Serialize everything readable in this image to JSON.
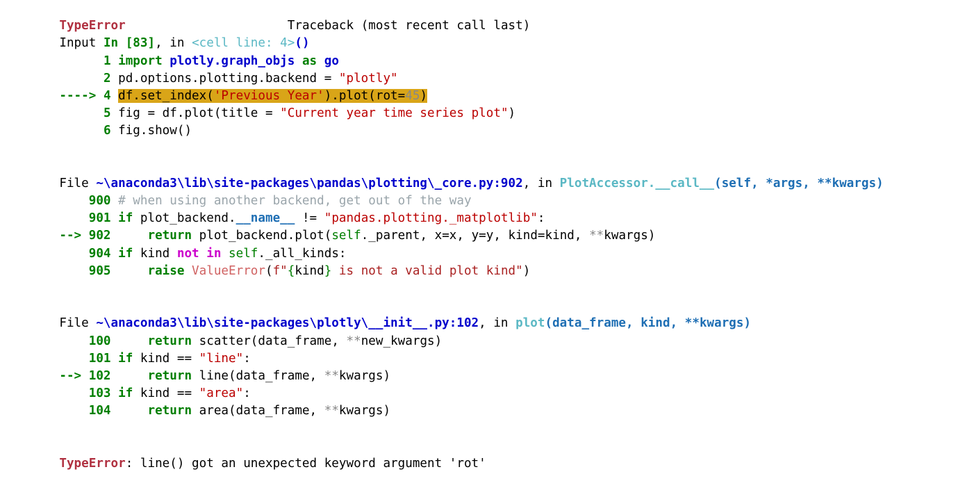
{
  "terminal": {
    "kind": "ipython-traceback",
    "background": "#ffffff",
    "exception_type": "TypeError",
    "traceback_header": "Traceback (most recent call last)",
    "final_message_label": "TypeError",
    "final_message_text": ": line() got an unexpected keyword argument 'rot'",
    "colors": {
      "error_red": "#b03040",
      "keyword_green": "#007f00",
      "module_blue": "#0000cc",
      "func_cyan": "#5bb8c4",
      "string_red": "#bb0000",
      "comment_grey": "#9aa5ab",
      "highlight_gold": "#d9a518",
      "magenta_keyword": "#cc00cc",
      "valueerror_salmon": "#d06262",
      "splat_grey": "#888888"
    }
  },
  "frames": {
    "frame1": {
      "location_prefix": "Input ",
      "cell_id": "In [83]",
      "location_middle": ", in ",
      "cell_scope": "<cell line: 4>",
      "call_parens": "()",
      "lines": [
        {
          "num": "1",
          "arrow": "",
          "highlight": false
        },
        {
          "num": "2",
          "arrow": "",
          "highlight": false
        },
        {
          "num": "4",
          "arrow": "---->",
          "highlight": true
        },
        {
          "num": "5",
          "arrow": "",
          "highlight": false
        },
        {
          "num": "6",
          "arrow": "",
          "highlight": false
        }
      ],
      "code": {
        "l1_import": "import",
        "l1_module": "plotly.graph_objs",
        "l1_as": "as",
        "l1_alias": "go",
        "l2_expr": "pd.options.plotting.backend = ",
        "l2_str": "\"plotly\"",
        "l4_a": "df.set_index(",
        "l4_str": "'Previous Year'",
        "l4_b": ").plot(rot=",
        "l4_num": "45",
        "l4_c": ")",
        "l5_a": "fig = df.plot(title = ",
        "l5_str": "\"Current year time series plot\"",
        "l5_b": ")",
        "l6": "fig.show()"
      }
    },
    "frame2": {
      "file_word": "File ",
      "path": "~\\anaconda3\\lib\\site-packages\\pandas\\plotting\\_core.py:902",
      "in_word": ", in ",
      "func_name": "PlotAccessor.__call__",
      "signature": "(self, *args, **kwargs)",
      "lines": [
        {
          "num": "900",
          "arrow": "",
          "highlight": false
        },
        {
          "num": "901",
          "arrow": "",
          "highlight": false
        },
        {
          "num": "902",
          "arrow": "-->",
          "highlight": false
        },
        {
          "num": "904",
          "arrow": "",
          "highlight": false
        },
        {
          "num": "905",
          "arrow": "",
          "highlight": false
        }
      ],
      "code": {
        "l900_comment": "# when using another backend, get out of the way",
        "l901_if": "if",
        "l901_a": " plot_backend.",
        "l901_dunder": "__name__",
        "l901_b": " != ",
        "l901_str": "\"pandas.plotting._matplotlib\"",
        "l901_c": ":",
        "l902_return": "return",
        "l902_a": " plot_backend.plot(",
        "l902_self": "self",
        "l902_b": "._parent, x=x, y=y, kind=kind, ",
        "l902_splat": "**",
        "l902_c": "kwargs)",
        "l904_if": "if",
        "l904_a": " kind ",
        "l904_notin": "not in",
        "l904_self": " self",
        "l904_b": "._all_kinds:",
        "l905_raise": "raise",
        "l905_valerr": " ValueError",
        "l905_a": "(",
        "l905_f": "f\"",
        "l905_lbrace": "{",
        "l905_kind": "kind",
        "l905_rbrace": "}",
        "l905_rest": " is not a valid plot kind\"",
        "l905_close": ")"
      }
    },
    "frame3": {
      "file_word": "File ",
      "path": "~\\anaconda3\\lib\\site-packages\\plotly\\__init__.py:102",
      "in_word": ", in ",
      "func_name": "plot",
      "signature": "(data_frame, kind, **kwargs)",
      "lines": [
        {
          "num": "100",
          "arrow": "",
          "highlight": false
        },
        {
          "num": "101",
          "arrow": "",
          "highlight": false
        },
        {
          "num": "102",
          "arrow": "-->",
          "highlight": false
        },
        {
          "num": "103",
          "arrow": "",
          "highlight": false
        },
        {
          "num": "104",
          "arrow": "",
          "highlight": false
        }
      ],
      "code": {
        "l100_return": "return",
        "l100_a": " scatter(data_frame, ",
        "l100_splat": "**",
        "l100_b": "new_kwargs)",
        "l101_if": "if",
        "l101_a": " kind == ",
        "l101_str": "\"line\"",
        "l101_b": ":",
        "l102_return": "return",
        "l102_a": " line(data_frame, ",
        "l102_splat": "**",
        "l102_b": "kwargs)",
        "l103_if": "if",
        "l103_a": " kind == ",
        "l103_str": "\"area\"",
        "l103_b": ":",
        "l104_return": "return",
        "l104_a": " area(data_frame, ",
        "l104_splat": "**",
        "l104_b": "kwargs)"
      }
    }
  }
}
